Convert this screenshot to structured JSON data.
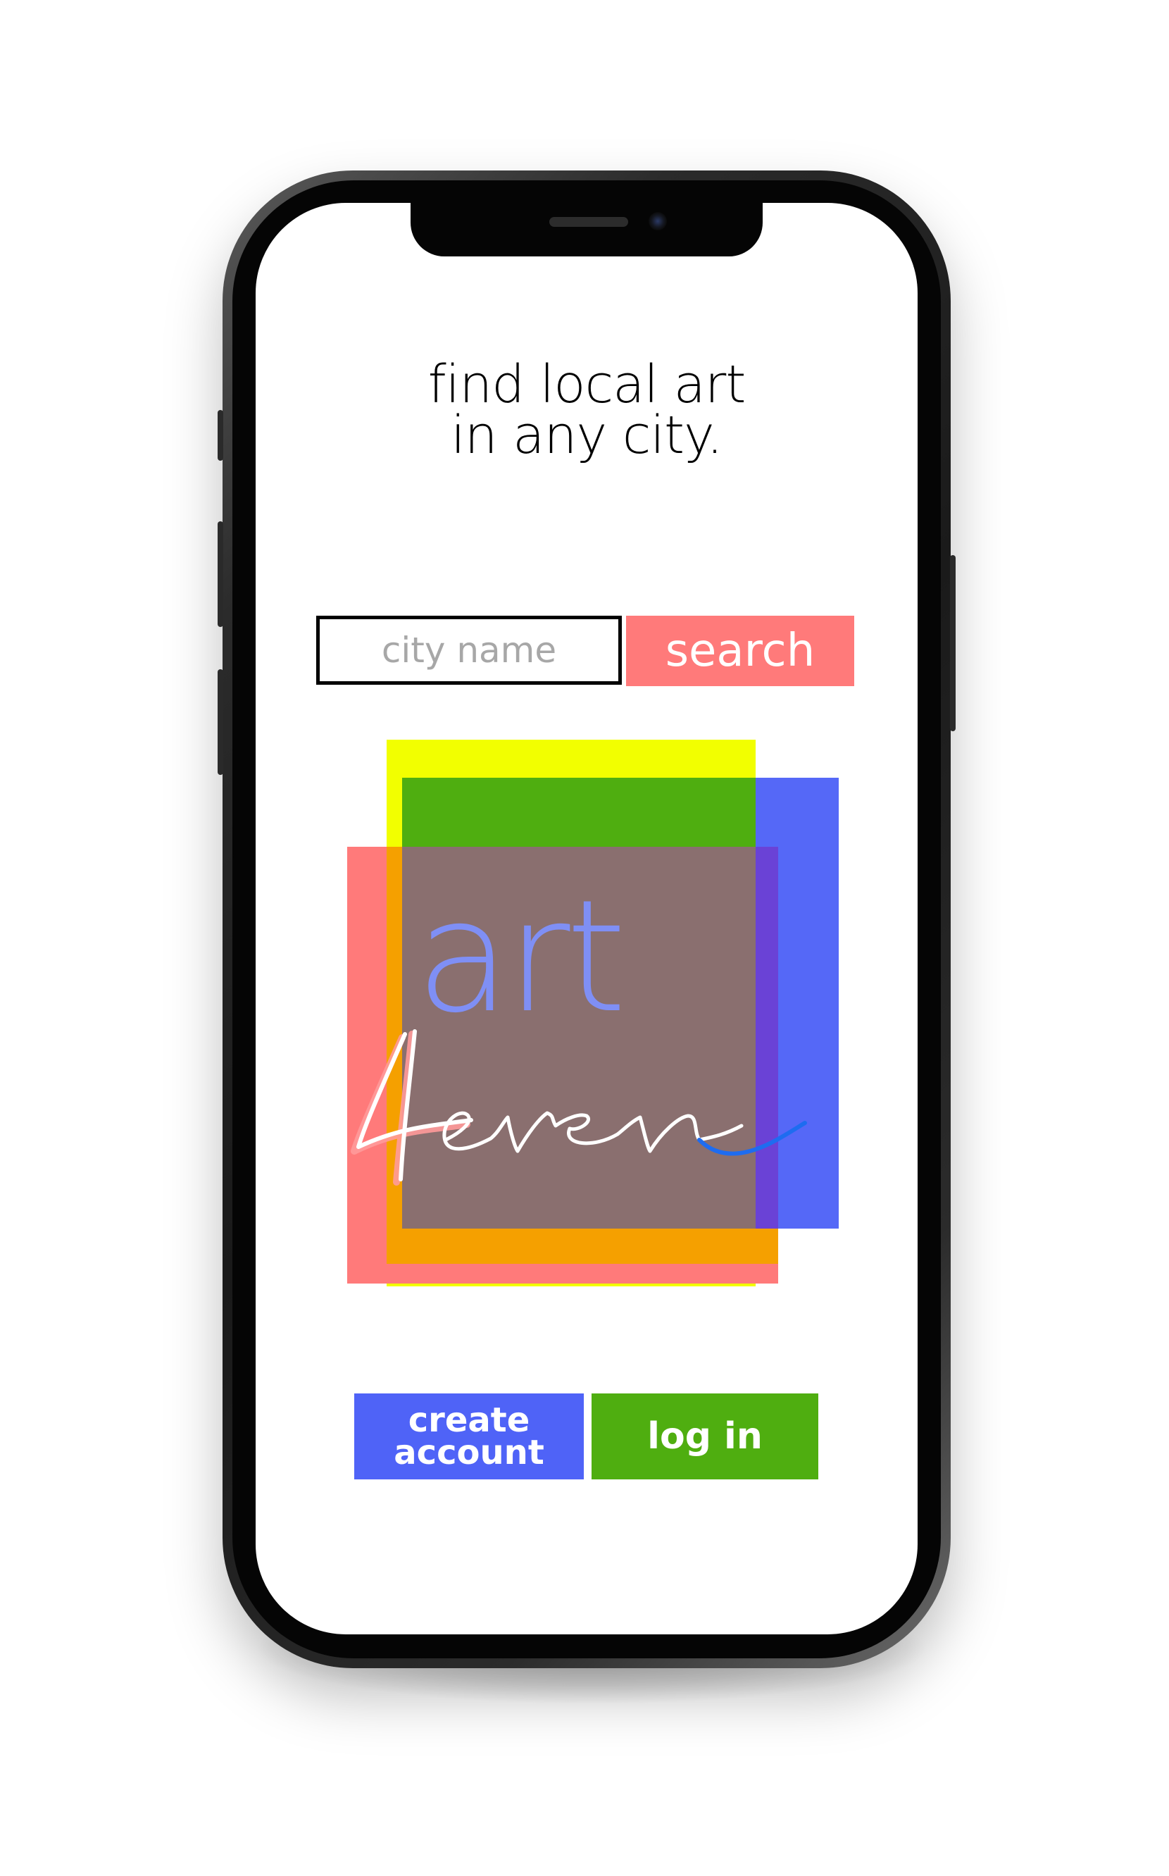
{
  "screen": {
    "headline_line1": "find local art",
    "headline_line2": "in any city.",
    "search": {
      "placeholder": "city name",
      "button_label": "search"
    },
    "logo": {
      "word_top": "art",
      "word_script": "4ever",
      "colors": {
        "yellow": "#f2ff00",
        "blue": "#4f63f7",
        "red": "#ff7a7a",
        "green": "#4fae10",
        "center": "#8a6f6f"
      }
    },
    "actions": {
      "create_line1": "create",
      "create_line2": "account",
      "login_label": "log in"
    }
  }
}
